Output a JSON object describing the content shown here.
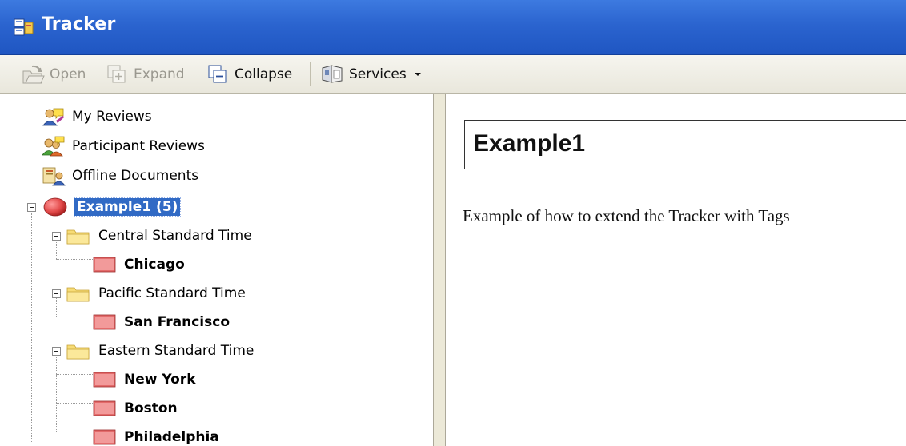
{
  "window": {
    "title": "Tracker"
  },
  "toolbar": {
    "open_label": "Open",
    "expand_label": "Expand",
    "collapse_label": "Collapse",
    "services_label": "Services"
  },
  "tree": {
    "my_reviews": "My Reviews",
    "participant_reviews": "Participant Reviews",
    "offline_documents": "Offline Documents",
    "root": "Example1 (5)",
    "groups": [
      {
        "label": "Central Standard Time",
        "cities": [
          "Chicago"
        ]
      },
      {
        "label": "Pacific Standard Time",
        "cities": [
          "San Francisco"
        ]
      },
      {
        "label": "Eastern Standard Time",
        "cities": [
          "New York",
          "Boston",
          "Philadelphia"
        ]
      }
    ]
  },
  "content": {
    "title": "Example1",
    "description": "Example of how to extend the Tracker with Tags"
  },
  "colors": {
    "titlebar": "#2b64cf",
    "selection": "#316ac5",
    "folder": "#f5d76e",
    "tag": "#e05a5a"
  }
}
